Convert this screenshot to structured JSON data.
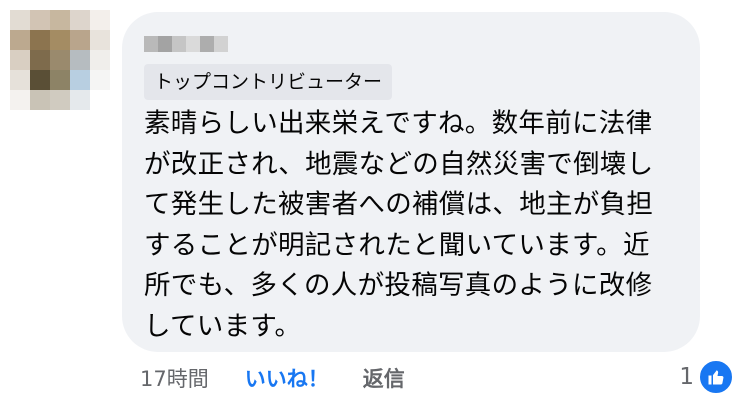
{
  "comment": {
    "badge": "トップコントリビューター",
    "lines": [
      "素晴らしい出来栄えですね。数年前に法律",
      "が改正され、地震などの自然災害で倒壊し",
      "て発生した被害者への補償は、地主が負担",
      "することが明記されたと聞いています。近",
      "所でも、多くの人が投稿写真のように改修",
      "しています。"
    ]
  },
  "actions": {
    "timestamp": "17時間",
    "like_label": "いいね！",
    "reply_label": "返信"
  },
  "reactions": {
    "count": "1",
    "icon": "thumbs-up-icon",
    "color": "#1877f2"
  },
  "colors": {
    "bubble": "#f0f2f5",
    "badge_bg": "#e4e6eb",
    "accent": "#1877f2",
    "muted_text": "#65676b"
  }
}
